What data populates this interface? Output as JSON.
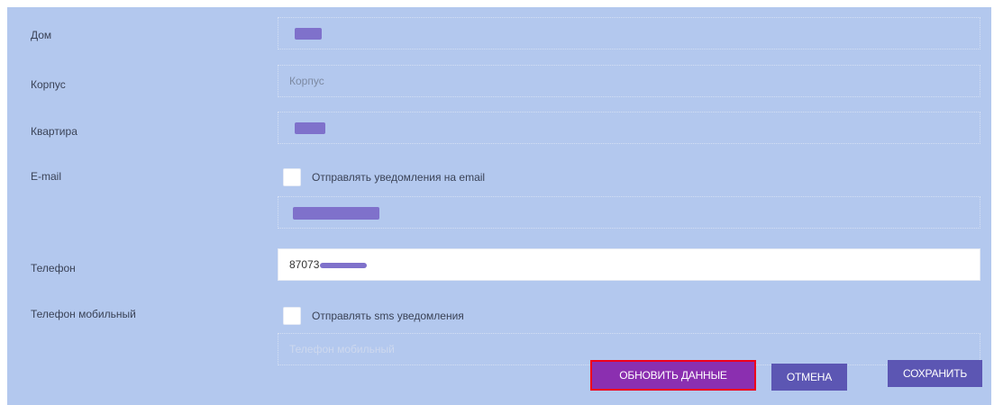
{
  "form": {
    "house": {
      "label": "Дом",
      "value": ""
    },
    "building": {
      "label": "Корпус",
      "value": "Корпус"
    },
    "apartment": {
      "label": "Квартира",
      "value": ""
    },
    "email": {
      "label": "E-mail",
      "checkbox_label": "Отправлять уведомления на email",
      "checked": false,
      "value": ""
    },
    "phone": {
      "label": "Телефон",
      "value": "87073"
    },
    "mobile": {
      "label": "Телефон мобильный",
      "checkbox_label": "Отправлять sms уведомления",
      "checked": false,
      "placeholder": "Телефон мобильный"
    }
  },
  "buttons": {
    "update": "ОБНОВИТЬ ДАННЫЕ",
    "cancel": "ОТМЕНА",
    "save": "СОХРАНИТЬ"
  },
  "colors": {
    "panel_bg": "#b3c8ee",
    "button_bg": "#5c56b3",
    "highlighted_button_bg": "#8b2fb0",
    "highlight_border": "#f0001a",
    "redaction": "#7f71cb"
  }
}
